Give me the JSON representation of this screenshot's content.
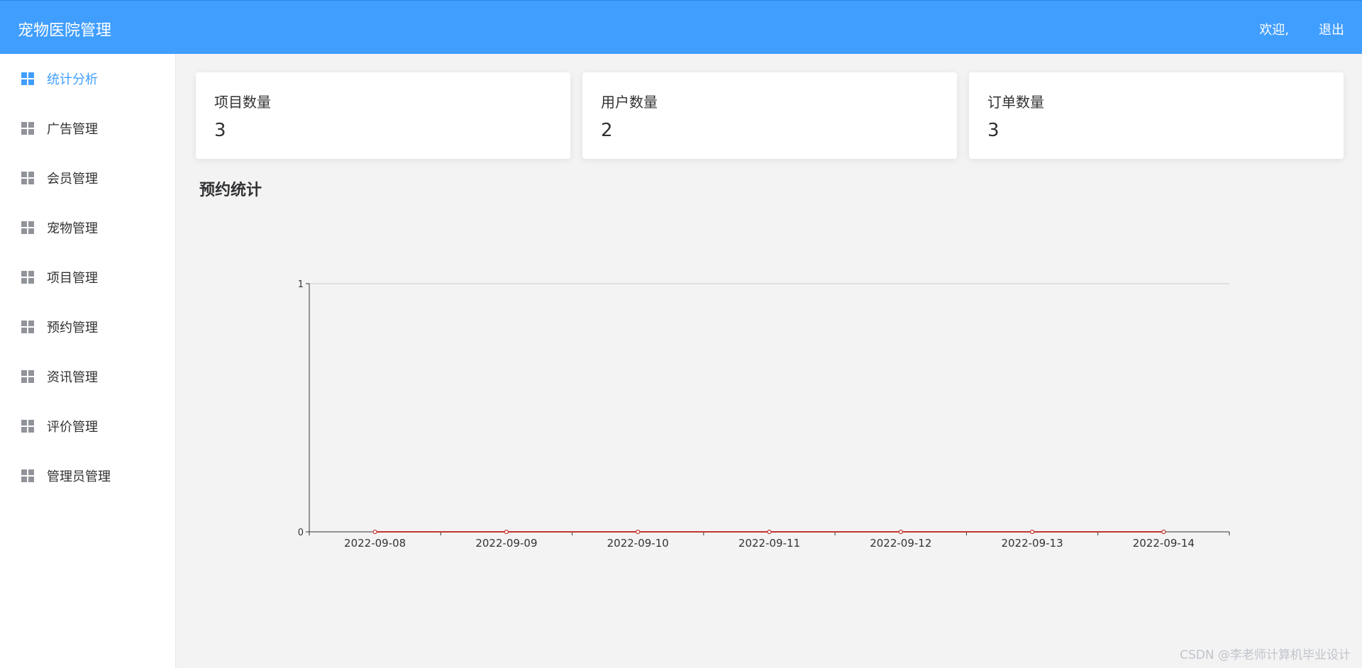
{
  "header": {
    "title": "宠物医院管理",
    "welcome": "欢迎,",
    "logout": "退出"
  },
  "sidebar": {
    "items": [
      {
        "label": "统计分析",
        "active": true
      },
      {
        "label": "广告管理"
      },
      {
        "label": "会员管理"
      },
      {
        "label": "宠物管理"
      },
      {
        "label": "项目管理"
      },
      {
        "label": "预约管理"
      },
      {
        "label": "资讯管理"
      },
      {
        "label": "评价管理"
      },
      {
        "label": "管理员管理"
      }
    ]
  },
  "stats": [
    {
      "label": "项目数量",
      "value": "3"
    },
    {
      "label": "用户数量",
      "value": "2"
    },
    {
      "label": "订单数量",
      "value": "3"
    }
  ],
  "section_title": "预约统计",
  "chart_data": {
    "type": "line",
    "x": [
      "2022-09-08",
      "2022-09-09",
      "2022-09-10",
      "2022-09-11",
      "2022-09-12",
      "2022-09-13",
      "2022-09-14"
    ],
    "values": [
      0,
      0,
      0,
      0,
      0,
      0,
      0
    ],
    "ylim": [
      0,
      1
    ],
    "yticks": [
      "0",
      "1"
    ],
    "grid": true,
    "colors": {
      "line": "#c23531",
      "axis": "#333333",
      "grid": "#cccccc"
    }
  },
  "watermark": "CSDN @李老师计算机毕业设计"
}
